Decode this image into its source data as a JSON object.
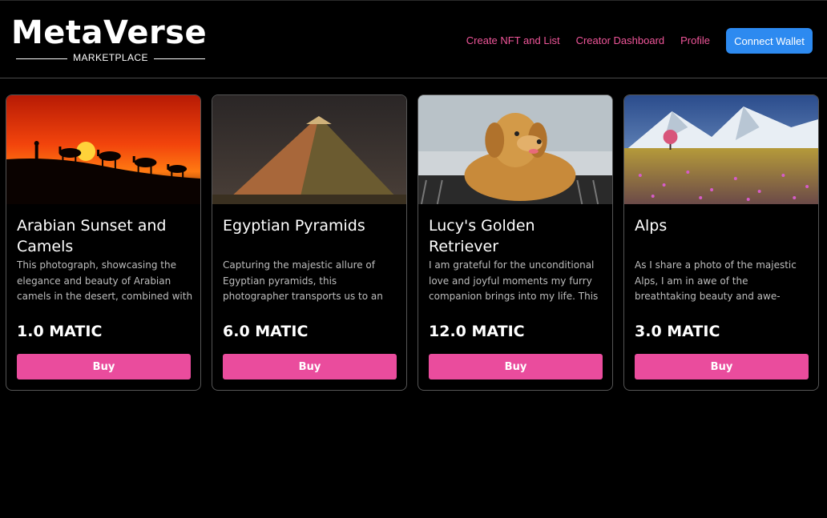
{
  "header": {
    "logo_word": "MetaVerse",
    "logo_sub": "MARKETPLACE",
    "nav": [
      {
        "label": "Create NFT and List"
      },
      {
        "label": "Creator Dashboard"
      },
      {
        "label": "Profile"
      }
    ],
    "connect_label": "Connect Wallet"
  },
  "colors": {
    "accent_pink": "#ea4c9d",
    "nav_pink": "#f0569a",
    "connect_blue": "#2d8af0",
    "background": "#000000"
  },
  "cards": [
    {
      "title": "Arabian Sunset and Camels",
      "description": "This photograph, showcasing the elegance and beauty of Arabian camels in the desert, combined with",
      "price": "1.0 MATIC",
      "buy_label": "Buy",
      "image_icon": "sunset-camels-image"
    },
    {
      "title": "Egyptian Pyramids",
      "description": "Capturing the majestic allure of Egyptian pyramids, this photographer transports us to an ancient world",
      "price": "6.0 MATIC",
      "buy_label": "Buy",
      "image_icon": "pyramid-image"
    },
    {
      "title": "Lucy's Golden Retriever",
      "description": "I am grateful for the unconditional love and joyful moments my furry companion brings into my life. This",
      "price": "12.0 MATIC",
      "buy_label": "Buy",
      "image_icon": "golden-retriever-image"
    },
    {
      "title": "Alps",
      "description": "As I share a photo of the majestic Alps, I am in awe of the breathtaking beauty and awe-inspiring grandeur",
      "price": "3.0 MATIC",
      "buy_label": "Buy",
      "image_icon": "alps-image"
    }
  ]
}
